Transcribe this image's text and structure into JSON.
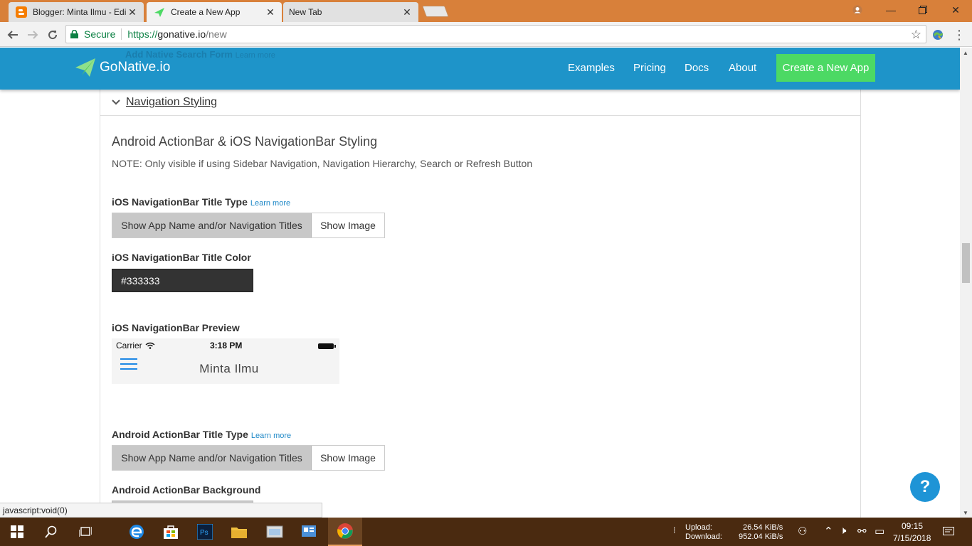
{
  "browser": {
    "tabs": [
      {
        "title": "Blogger: Minta Ilmu - Edi",
        "icon": "blogger-icon",
        "active": false
      },
      {
        "title": "Create a New App",
        "icon": "gonative-icon",
        "active": true
      },
      {
        "title": "New Tab",
        "icon": "",
        "active": false
      }
    ],
    "secure_label": "Secure",
    "url_scheme": "https://",
    "url_host": "gonative.io",
    "url_path": "/new",
    "status_text": "javascript:void(0)"
  },
  "site": {
    "ghost_text": "Add Native Search Form",
    "ghost_learn": "Learn more",
    "brand": "GoNative.io",
    "nav": [
      "Examples",
      "Pricing",
      "Docs",
      "About"
    ],
    "cta": "Create a New App",
    "accent": "#1e94c9",
    "cta_color": "#4cd964"
  },
  "section": {
    "title": "Navigation Styling",
    "heading": "Android ActionBar & iOS NavigationBar Styling",
    "note": "NOTE: Only visible if using Sidebar Navigation, Navigation Hierarchy, Search or Refresh Button",
    "ios_title_type": {
      "label": "iOS NavigationBar Title Type",
      "learn": "Learn more",
      "option_selected": "Show App Name and/or Navigation Titles",
      "option_other": "Show Image"
    },
    "ios_title_color": {
      "label": "iOS NavigationBar Title Color",
      "value": "#333333"
    },
    "ios_preview": {
      "label": "iOS NavigationBar Preview",
      "carrier": "Carrier",
      "time": "3:18 PM",
      "title": "Minta Ilmu"
    },
    "android_title_type": {
      "label": "Android ActionBar Title Type",
      "learn": "Learn more",
      "option_selected": "Show App Name and/or Navigation Titles",
      "option_other": "Show Image"
    },
    "android_background": {
      "label": "Android ActionBar Background"
    }
  },
  "help_label": "?",
  "taskbar": {
    "upload_label": "Upload:",
    "upload_value": "26.54 KiB/s",
    "download_label": "Download:",
    "download_value": "952.04 KiB/s",
    "time": "09:15",
    "date": "7/15/2018"
  }
}
